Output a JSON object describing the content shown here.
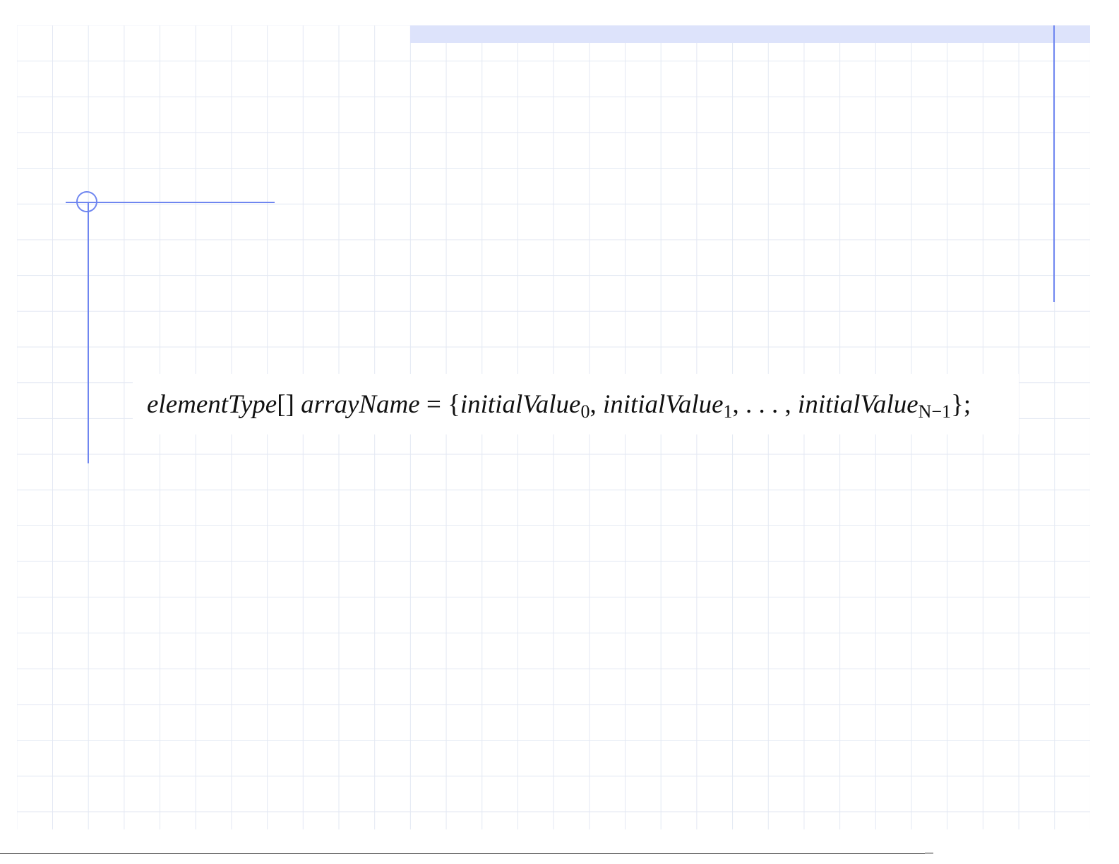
{
  "slide": {
    "formula": {
      "type_name": "elementType",
      "brackets": "[]",
      "array_name": "arrayName",
      "equals": " = ",
      "open_brace": "{",
      "value_0": "initialValue",
      "sub_0": "0",
      "sep_1": ", ",
      "value_1": "initialValue",
      "sub_1": "1",
      "ellipsis": ", . . . , ",
      "value_n": "initialValue",
      "sub_n": "N−1",
      "close": "};"
    }
  },
  "colors": {
    "accent_line": "#6f86f0",
    "top_bar": "#dde3fb",
    "grid": "#e3e8f3"
  }
}
